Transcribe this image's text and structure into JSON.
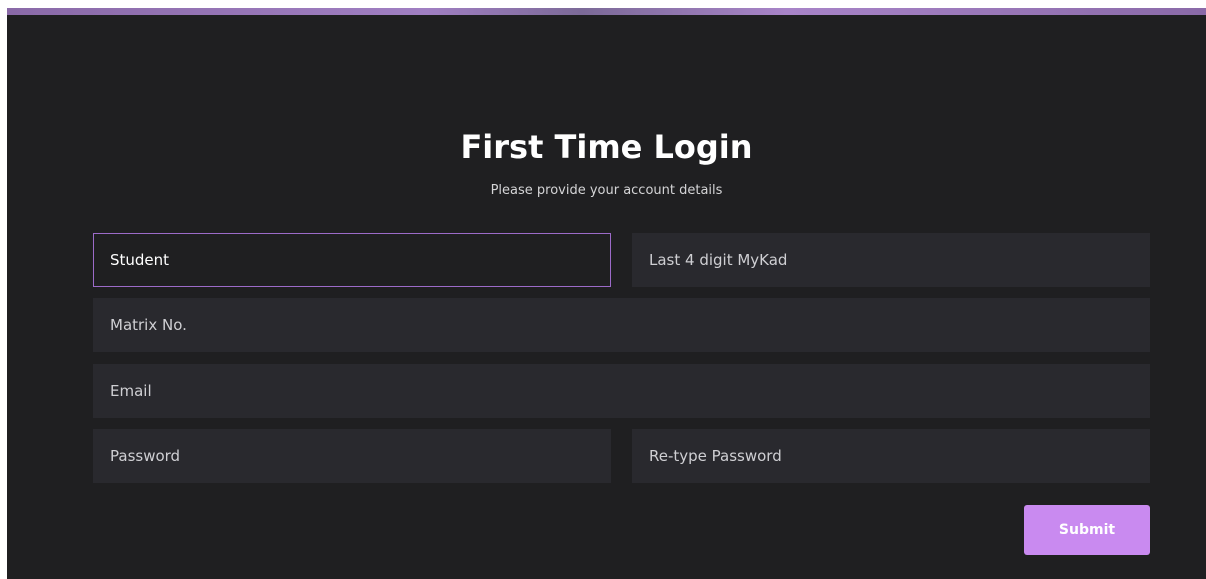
{
  "form": {
    "title": "First Time Login",
    "subtitle": "Please provide your account details",
    "fields": {
      "student": "Student",
      "mykad": "Last 4 digit MyKad",
      "matrix": "Matrix No.",
      "email": "Email",
      "password": "Password",
      "retype_password": "Re-type Password"
    },
    "submit_label": "Submit"
  },
  "colors": {
    "background": "#1f1f21",
    "field_background": "#29292e",
    "active_border": "#9c6bc9",
    "accent": "#c98af0"
  }
}
